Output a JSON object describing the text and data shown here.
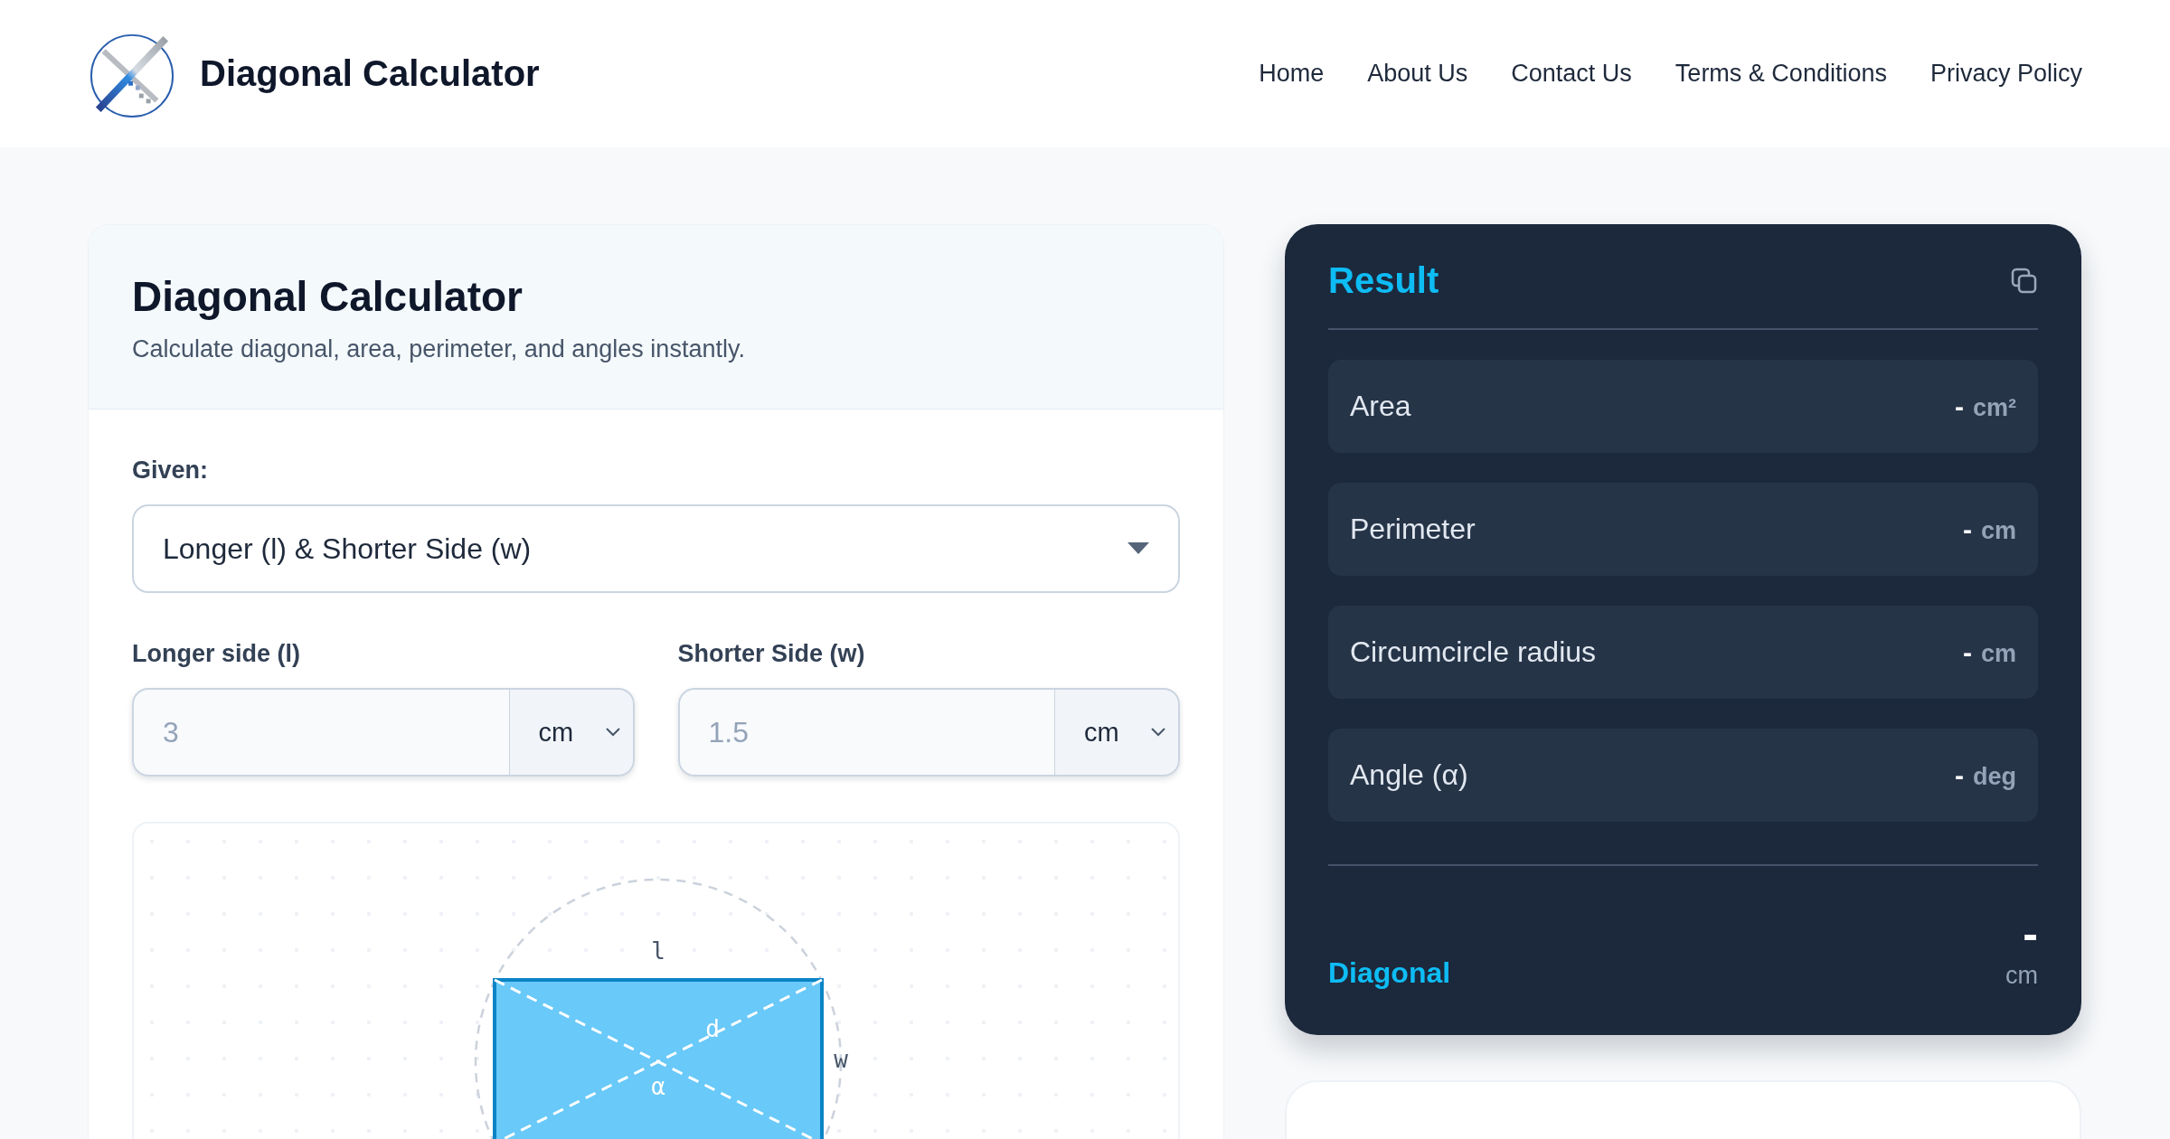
{
  "header": {
    "logo_text": "Diagonal Calculator",
    "nav": [
      {
        "label": "Home"
      },
      {
        "label": "About Us"
      },
      {
        "label": "Contact Us"
      },
      {
        "label": "Terms & Conditions"
      },
      {
        "label": "Privacy Policy"
      }
    ]
  },
  "calculator": {
    "title": "Diagonal Calculator",
    "subtitle": "Calculate diagonal, area, perimeter, and angles instantly.",
    "given": {
      "label": "Given:",
      "value": "Longer (l) & Shorter Side (w)"
    },
    "inputs": [
      {
        "label": "Longer side (l)",
        "placeholder": "3",
        "unit": "cm"
      },
      {
        "label": "Shorter Side (w)",
        "placeholder": "1.5",
        "unit": "cm"
      }
    ],
    "diagram": {
      "length_label": "l",
      "width_label": "w",
      "diagonal_label": "d",
      "angle_label": "α"
    }
  },
  "result": {
    "title": "Result",
    "rows": [
      {
        "label": "Area",
        "value": "-",
        "unit": "cm²"
      },
      {
        "label": "Perimeter",
        "value": "-",
        "unit": "cm"
      },
      {
        "label": "Circumcircle radius",
        "value": "-",
        "unit": "cm"
      },
      {
        "label": "Angle (α)",
        "value": "-",
        "unit": "deg"
      }
    ],
    "diagonal": {
      "label": "Diagonal",
      "value": "-",
      "unit": "cm"
    }
  }
}
